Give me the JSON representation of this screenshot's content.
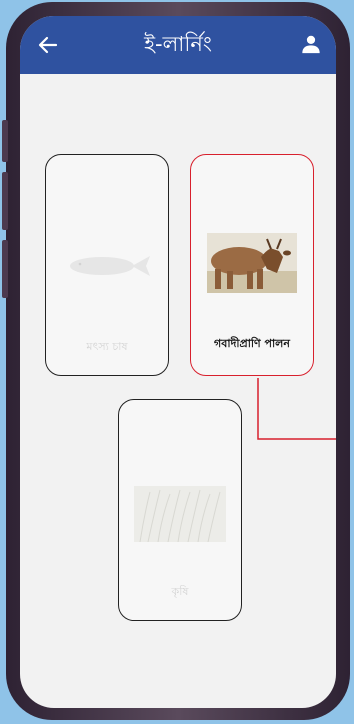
{
  "header": {
    "title": "ই-লার্নিং",
    "back_icon": "arrow-left-icon",
    "profile_icon": "user-icon",
    "background": "#2f52a0"
  },
  "categories": [
    {
      "label": "মৎস্য চাষ",
      "image": "fish",
      "state": "faded"
    },
    {
      "label": "গবাদীপ্রাণি পালন",
      "image": "cow",
      "state": "selected"
    },
    {
      "label": "কৃষি",
      "image": "rice-field",
      "state": "faded"
    }
  ],
  "colors": {
    "accent": "#d8202d",
    "screen_background": "#f2f2f2",
    "card_border": "#222222"
  }
}
